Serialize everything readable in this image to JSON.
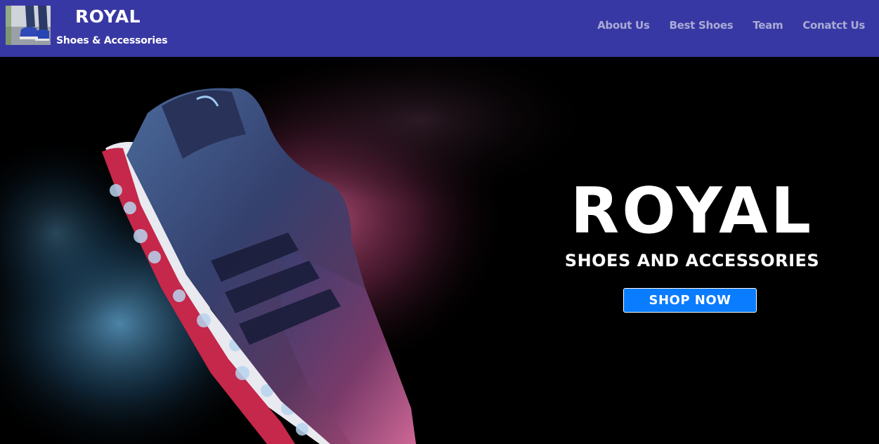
{
  "header": {
    "brand_title": "ROYAL",
    "brand_subtitle": "Shoes & Accessories",
    "nav": [
      "About Us",
      "Best Shoes",
      "Team",
      "Conatct Us"
    ]
  },
  "hero": {
    "title": "ROYAL",
    "subtitle": "SHOES AND ACCESSORIES",
    "cta_label": "SHOP NOW"
  },
  "colors": {
    "navbar_bg": "#3838a4",
    "nav_link": "#a9abd6",
    "cta_bg": "#0a7cff",
    "hero_bg": "#000000"
  },
  "icons": {
    "logo": "shoe-photo-thumbnail",
    "hero_image": "golf-shoe-with-smoke"
  }
}
